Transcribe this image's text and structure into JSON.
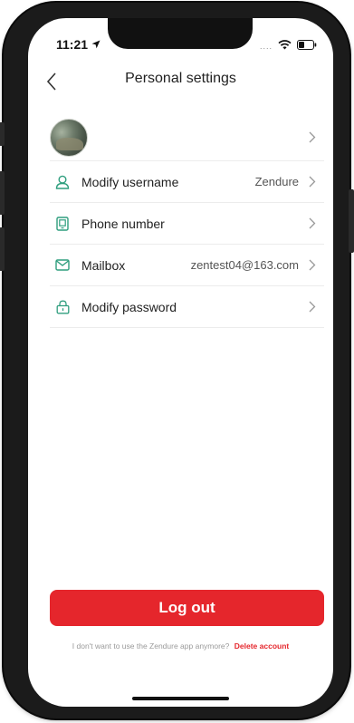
{
  "status_bar": {
    "time": "11:21",
    "signal_dots": "....",
    "icons": [
      "location-arrow-icon",
      "wifi-icon",
      "battery-icon"
    ]
  },
  "nav": {
    "title": "Personal settings",
    "back_icon": "chevron-left-icon"
  },
  "profile": {
    "avatar": "avatar"
  },
  "settings": {
    "items": [
      {
        "label": "Modify username",
        "value": "Zendure",
        "icon": "user-icon"
      },
      {
        "label": "Phone number",
        "value": "",
        "icon": "phone-icon"
      },
      {
        "label": "Mailbox",
        "value": "zentest04@163.com",
        "icon": "mail-icon"
      },
      {
        "label": "Modify password",
        "value": "",
        "icon": "lock-icon"
      }
    ]
  },
  "actions": {
    "logout_label": "Log out",
    "footer_text": "I don't want to use the Zendure app anymore?",
    "delete_label": "Delete account"
  },
  "colors": {
    "accent_red": "#e5262c",
    "icon_green": "#2f9e7e",
    "text_primary": "#222222",
    "divider": "#ececec"
  }
}
